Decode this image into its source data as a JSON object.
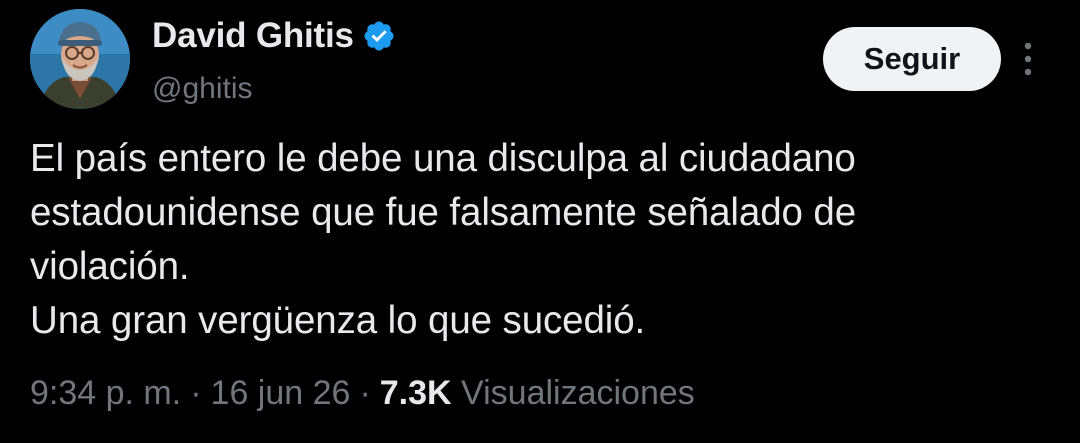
{
  "author": {
    "display_name": "David Ghitis",
    "handle": "@ghitis",
    "verified_icon": "verified-badge-icon",
    "avatar_icon": "user-avatar"
  },
  "actions": {
    "follow_label": "Seguir",
    "more_icon": "more-vertical-icon"
  },
  "tweet": {
    "lines": [
      "El país entero le debe una disculpa al ciudadano",
      "estadounidense que fue falsamente señalado de",
      "violación.",
      "Una gran vergüenza lo que sucedió."
    ]
  },
  "meta": {
    "time": "9:34 p. m.",
    "separator": "·",
    "date": "16 jun 26",
    "views_count": "7.3K",
    "views_label": "Visualizaciones"
  },
  "colors": {
    "background": "#000000",
    "primary_text": "#e7e9ea",
    "secondary_text": "#71767b",
    "verified": "#1d9bf0",
    "follow_button_bg": "#eff3f4"
  }
}
